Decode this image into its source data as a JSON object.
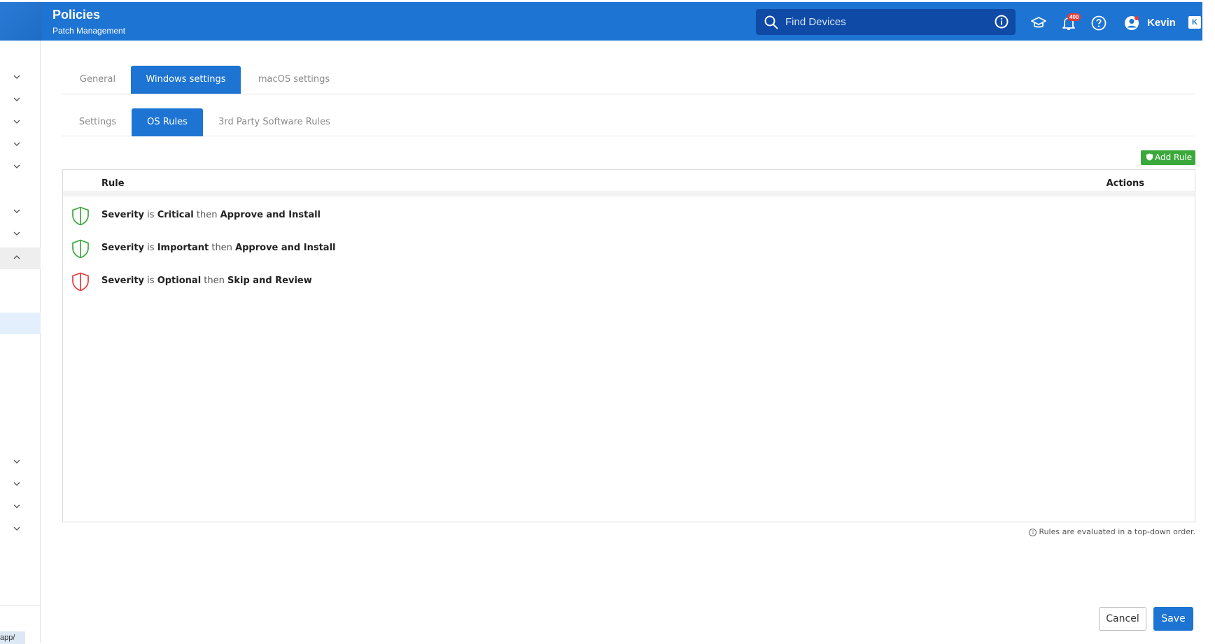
{
  "header": {
    "title": "Policies",
    "subtitle": "Patch Management",
    "search_placeholder": "Find Devices",
    "notification_count": "400",
    "user_name": "Kevin",
    "collapse_label": "K",
    "accent_color": "#1e74d2"
  },
  "sidebar": {
    "url_fragment": "app/"
  },
  "tabs_primary": [
    {
      "label": "General",
      "active": false
    },
    {
      "label": "Windows settings",
      "active": true
    },
    {
      "label": "macOS settings",
      "active": false
    }
  ],
  "tabs_secondary": [
    {
      "label": "Settings",
      "active": false
    },
    {
      "label": "OS Rules",
      "active": true
    },
    {
      "label": "3rd Party Software Rules",
      "active": false
    }
  ],
  "toolbar": {
    "add_rule_label": "Add Rule"
  },
  "rules_table": {
    "col_rule": "Rule",
    "col_actions": "Actions",
    "rows": [
      {
        "field": "Severity",
        "op": "is",
        "value": "Critical",
        "then": "then",
        "action": "Approve and Install",
        "shield_color": "#3aa83a"
      },
      {
        "field": "Severity",
        "op": "is",
        "value": "Important",
        "then": "then",
        "action": "Approve and Install",
        "shield_color": "#3aa83a"
      },
      {
        "field": "Severity",
        "op": "is",
        "value": "Optional",
        "then": "then",
        "action": "Skip and Review",
        "shield_color": "#e23b3b"
      }
    ]
  },
  "footer": {
    "note": "Rules are evaluated in a top-down order.",
    "cancel_label": "Cancel",
    "save_label": "Save"
  }
}
